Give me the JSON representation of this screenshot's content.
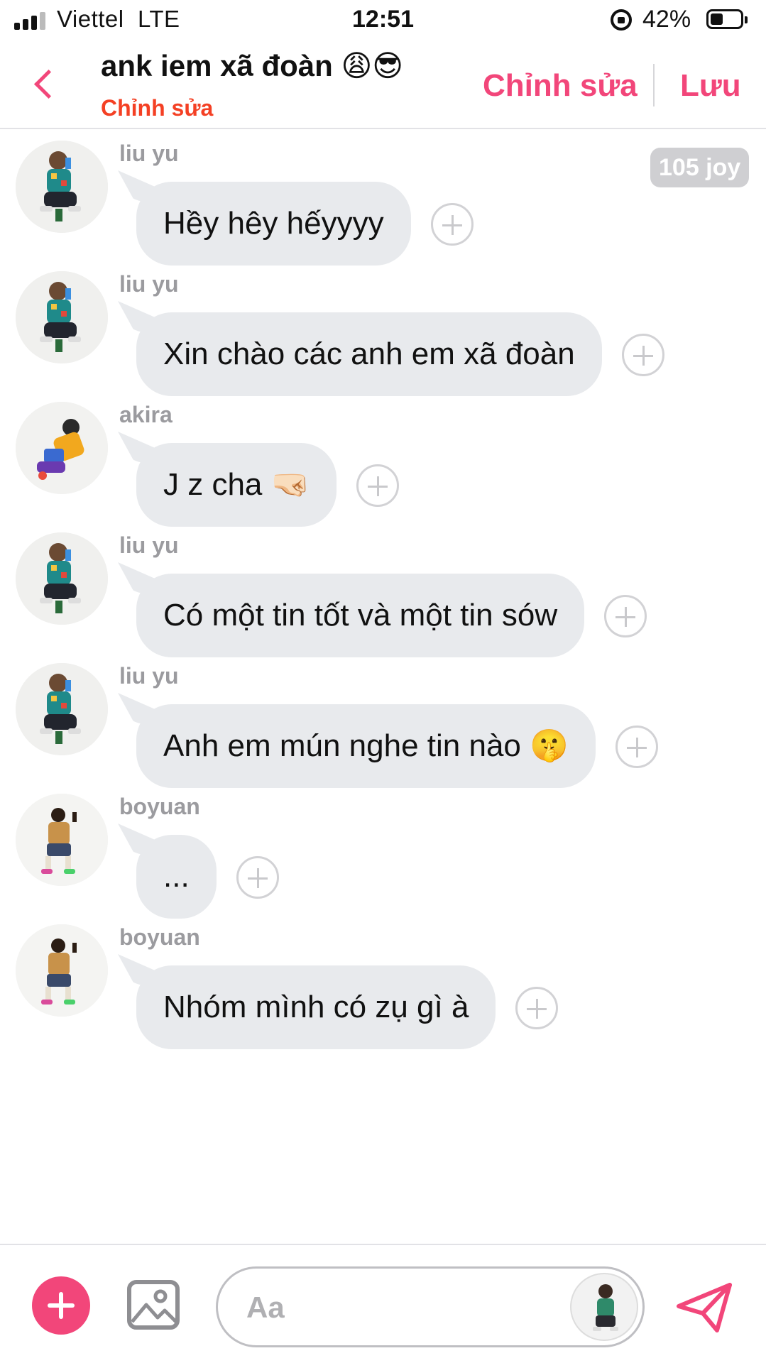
{
  "status_bar": {
    "carrier": "Viettel",
    "network": "LTE",
    "time": "12:51",
    "battery_percent": "42%",
    "battery_level": 0.42
  },
  "header": {
    "title": "ank iem xã đoàn 😩😎",
    "subtitle": "Chỉnh sửa",
    "edit_label": "Chỉnh sửa",
    "save_label": "Lưu",
    "accent_color": "#f2467a"
  },
  "joy_badge": "105 joy",
  "messages": [
    {
      "sender": "liu yu",
      "text": "Hềy hêy hếyyyy",
      "avatar": "liu-yu"
    },
    {
      "sender": "liu yu",
      "text": "Xin chào các anh em xã đoàn",
      "avatar": "liu-yu"
    },
    {
      "sender": "akira",
      "text": "J z cha 🤜🏻",
      "avatar": "akira"
    },
    {
      "sender": "liu yu",
      "text": "Có một tin tốt và một tin sów",
      "avatar": "liu-yu"
    },
    {
      "sender": "liu yu",
      "text": "Anh em mún nghe tin nào 🤫",
      "avatar": "liu-yu"
    },
    {
      "sender": "boyuan",
      "text": "...",
      "avatar": "boyuan"
    },
    {
      "sender": "boyuan",
      "text": "Nhóm mình có zụ gì à",
      "avatar": "boyuan"
    }
  ],
  "composer": {
    "placeholder": "Aa",
    "value": ""
  },
  "icons": {
    "back": "chevron-left-icon",
    "add": "plus-icon",
    "image": "image-icon",
    "send": "send-icon",
    "react": "add-reaction-icon"
  }
}
